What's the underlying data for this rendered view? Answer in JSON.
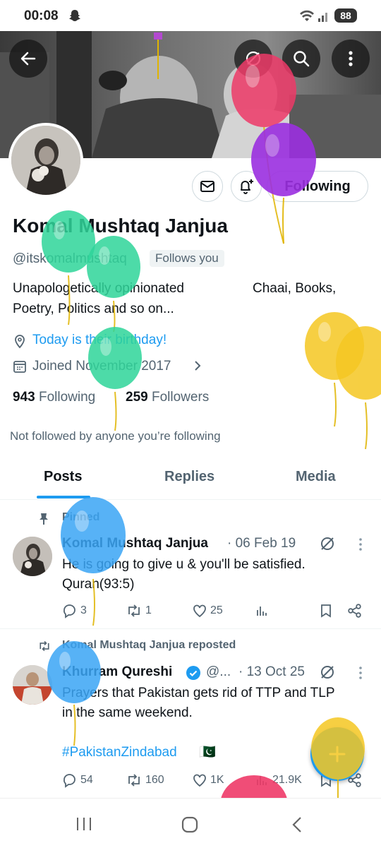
{
  "status_bar": {
    "time": "00:08",
    "battery": "88"
  },
  "profile": {
    "display_name": "Komal Mushtaq Janjua",
    "handle": "@itskomalmushtaq",
    "follows_you": "Follows you",
    "follow_button": "Following",
    "bio_line1_left": "Unapologetically opinionated",
    "bio_line1_right": "Chaai, Books,",
    "bio_line2": "Poetry, Politics and so on...",
    "birthday": "Today is their birthday!",
    "joined": "Joined November 2017",
    "following_count": "943",
    "following_label": "Following",
    "followers_count": "259",
    "followers_label": "Followers",
    "not_followed": "Not followed by anyone you’re following"
  },
  "tabs": [
    {
      "label": "Posts"
    },
    {
      "label": "Replies"
    },
    {
      "label": "Media"
    }
  ],
  "posts": [
    {
      "context": "Pinned",
      "author": "Komal Mushtaq Janjua",
      "date": "· 06 Feb 19",
      "text_line1": "He is going to give u & you'll be satisfied.",
      "text_line2": "Quran(93:5)",
      "replies": "3",
      "reposts": "1",
      "likes": "25"
    },
    {
      "context": "Komal Mushtaq Janjua reposted",
      "author": "Khurram Qureshi",
      "handle": "@...",
      "date": "· 13 Oct 25",
      "text_line1": "Prayers that Pakistan gets rid of TTP and TLP",
      "text_line2": "in the same weekend.",
      "hashtag": "#PakistanZindabad",
      "flag": "🇵🇰",
      "replies": "54",
      "reposts": "160",
      "likes": "1K",
      "views": "21.9K"
    }
  ],
  "colors": {
    "accent": "#1d9bf0",
    "text": "#0f1419",
    "muted": "#536471"
  }
}
